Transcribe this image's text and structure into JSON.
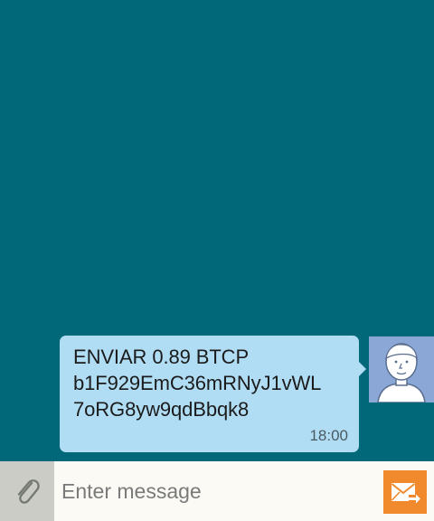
{
  "conversation": {
    "messages": [
      {
        "text": "ENVIAR 0.89 BTCP\nb1F929EmC36mRNyJ1vWL\n7oRG8yw9qdBbqk8",
        "time": "18:00",
        "direction": "sent",
        "bubble_color": "#b0ddf4"
      }
    ]
  },
  "composer": {
    "placeholder": "Enter message",
    "value": "",
    "attach_icon": "paperclip-icon",
    "send_icon": "envelope-send-icon"
  },
  "colors": {
    "chat_background": "#006878",
    "avatar_background": "#8ba7d6",
    "send_button": "#f08a2c",
    "attach_background": "#cbccc6",
    "input_background": "#fbfaf5"
  }
}
